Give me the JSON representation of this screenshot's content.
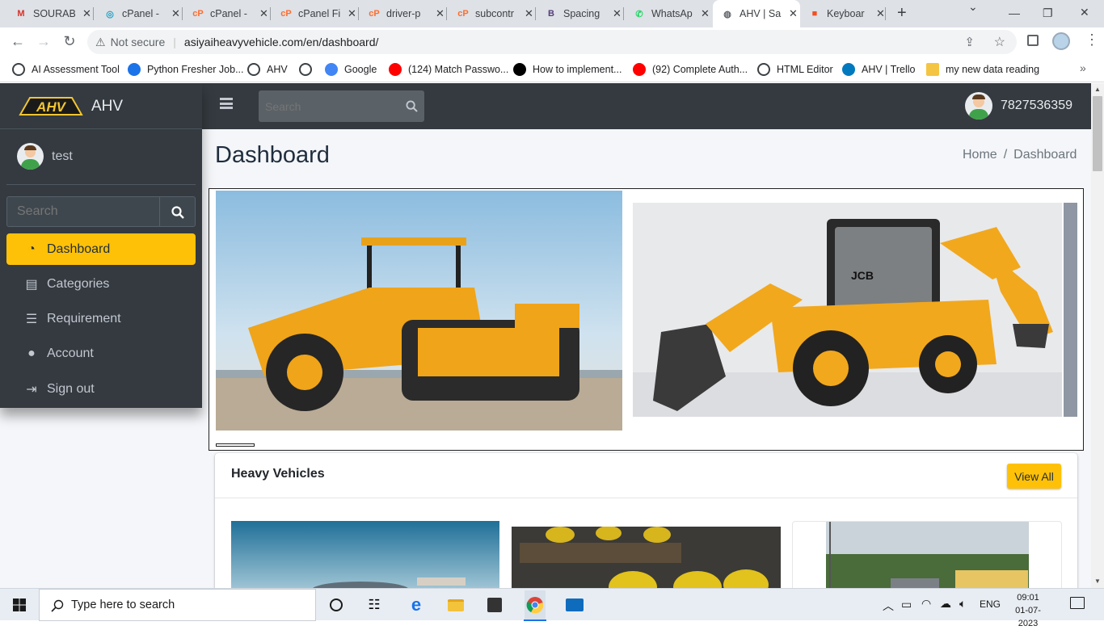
{
  "browser": {
    "tabs": [
      {
        "label": "SOURAB",
        "icon": "gmail-icon",
        "color": "#d93025",
        "glyph": "M"
      },
      {
        "label": "cPanel -",
        "icon": "cpanel-swirl-icon",
        "color": "#21a1c4",
        "glyph": "◎"
      },
      {
        "label": "cPanel -",
        "icon": "cpanel-icon",
        "color": "#ff6c2c",
        "glyph": "cP"
      },
      {
        "label": "cPanel Fi",
        "icon": "cpanel-icon",
        "color": "#ff6c2c",
        "glyph": "cP"
      },
      {
        "label": "driver-p",
        "icon": "cpanel-icon",
        "color": "#ff6c2c",
        "glyph": "cP"
      },
      {
        "label": "subcontr",
        "icon": "cpanel-icon",
        "color": "#ff6c2c",
        "glyph": "cP"
      },
      {
        "label": "Spacing",
        "icon": "bootstrap-icon",
        "color": "#563d7c",
        "glyph": "B"
      },
      {
        "label": "WhatsAp",
        "icon": "whatsapp-icon",
        "color": "#25d366",
        "glyph": "✆"
      },
      {
        "label": "AHV | Sa",
        "icon": "globe-icon",
        "color": "#5f6368",
        "glyph": "◍"
      },
      {
        "label": "Keyboar",
        "icon": "microsoft-icon",
        "color": "#f25022",
        "glyph": "■"
      }
    ],
    "address": {
      "security_label": "Not secure",
      "url": "asiyaiheavyvehicle.com/en/dashboard/"
    },
    "bookmarks": [
      {
        "label": "AI Assessment Tool",
        "icon": "globe-icon",
        "color": "#5f6368"
      },
      {
        "label": "Python Fresher Job...",
        "icon": "info-icon",
        "color": "#1a73e8"
      },
      {
        "label": "AHV",
        "icon": "globe-icon",
        "color": "#5f6368"
      },
      {
        "label": "",
        "icon": "globe-icon",
        "color": "#5f6368"
      },
      {
        "label": "Google",
        "icon": "google-icon",
        "color": "#4285f4"
      },
      {
        "label": "(124) Match Passwo...",
        "icon": "youtube-icon",
        "color": "#ff0000"
      },
      {
        "label": "How to implement...",
        "icon": "medium-icon",
        "color": "#000000"
      },
      {
        "label": "(92) Complete Auth...",
        "icon": "youtube-icon",
        "color": "#ff0000"
      },
      {
        "label": "HTML Editor",
        "icon": "globe-icon",
        "color": "#5f6368"
      },
      {
        "label": "AHV | Trello",
        "icon": "trello-icon",
        "color": "#0079bf"
      },
      {
        "label": "my new data reading",
        "icon": "folder-icon",
        "color": "#f4c542"
      }
    ]
  },
  "app": {
    "brand": "AHV",
    "logo_text": "AHV",
    "user_name": "test",
    "phone": "7827536359",
    "top_search_placeholder": "Search",
    "sidebar_search_placeholder": "Search",
    "menu": [
      {
        "label": "Dashboard",
        "icon": "dashboard-gauge-icon",
        "active": true
      },
      {
        "label": "Categories",
        "icon": "clipboard-icon",
        "active": false
      },
      {
        "label": "Requirement",
        "icon": "list-icon",
        "active": false
      },
      {
        "label": "Account",
        "icon": "user-circle-icon",
        "active": false
      },
      {
        "label": "Sign out",
        "icon": "sign-out-icon",
        "active": false
      }
    ],
    "page_title": "Dashboard",
    "breadcrumb": {
      "home": "Home",
      "separator": "/",
      "current": "Dashboard"
    },
    "card": {
      "title": "Heavy Vehicles",
      "view_all": "View All"
    },
    "accent": "#ffc107",
    "sidebar_bg": "#343a40"
  },
  "taskbar": {
    "search_placeholder": "Type here to search",
    "language": "ENG",
    "time": "09:01",
    "date": "01-07-2023"
  }
}
